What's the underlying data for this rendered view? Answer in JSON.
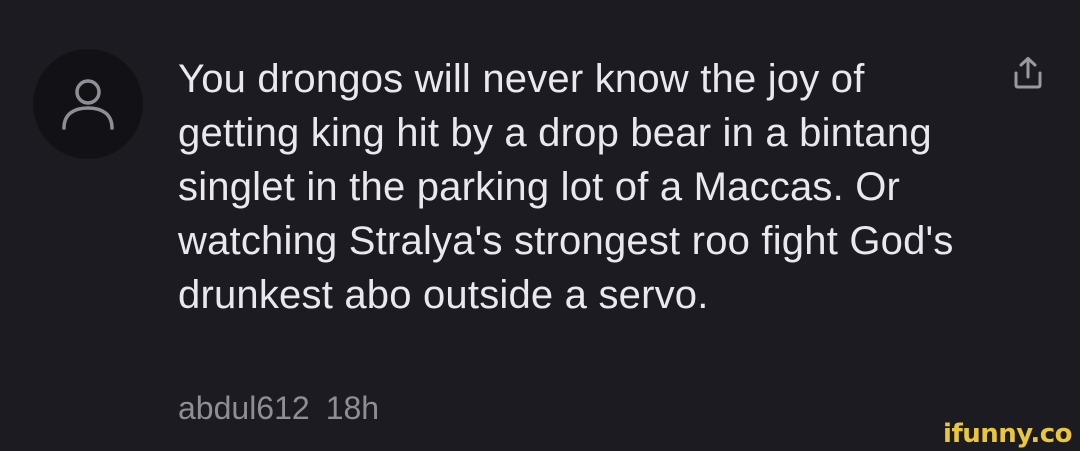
{
  "comment": {
    "text": "You drongos will never know the joy of getting king hit by a drop bear in a bintang singlet in the parking lot of a Maccas. Or watching Stralya's strongest roo fight God's drunkest abo outside a servo.",
    "author": "abdul612",
    "time": "18h"
  },
  "icons": {
    "avatar": "user-icon",
    "share": "share-upload-icon"
  },
  "watermark": {
    "text": "ifunny.co"
  },
  "colors": {
    "background": "#1c1b21",
    "text": "#e9e8ee",
    "meta": "#8f8e96",
    "watermark": "#f4d03f"
  }
}
